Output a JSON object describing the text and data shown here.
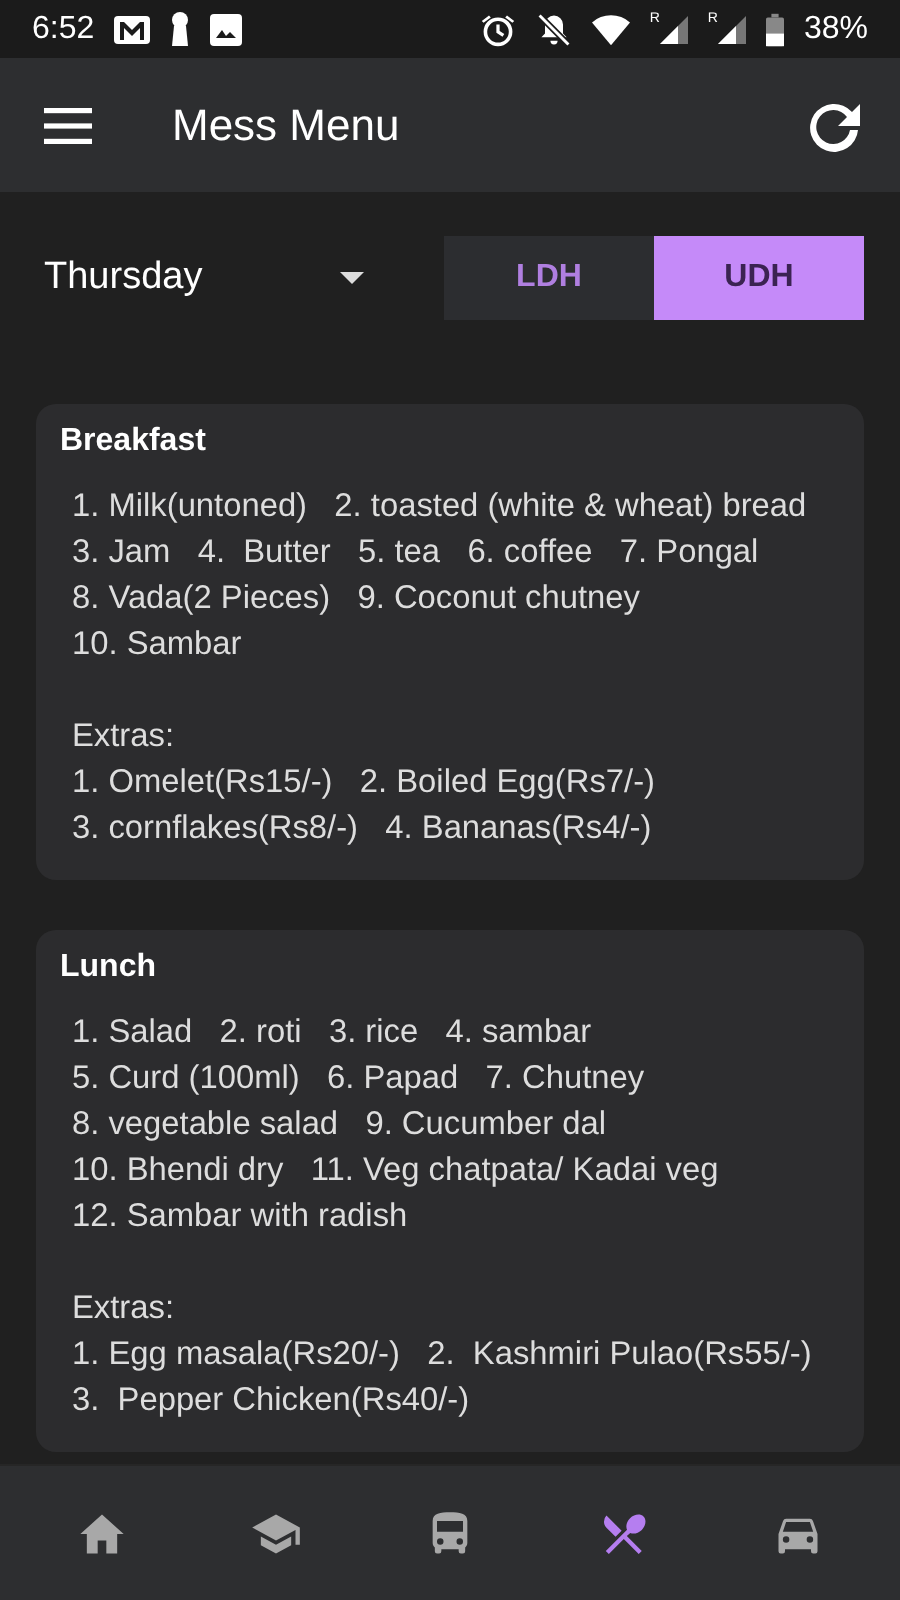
{
  "status_bar": {
    "time": "6:52",
    "signals": [
      {
        "roaming": "R"
      },
      {
        "roaming": "R"
      }
    ],
    "battery": "38%"
  },
  "app_bar": {
    "title": "Mess Menu"
  },
  "day_dropdown": {
    "value": "Thursday"
  },
  "hall_toggle": [
    {
      "label": "LDH",
      "selected": false
    },
    {
      "label": "UDH",
      "selected": true
    }
  ],
  "meals": [
    {
      "title": "Breakfast",
      "lines": [
        "1. Milk(untoned)   2. toasted (white & wheat) bread",
        "3. Jam   4.  Butter   5. tea   6. coffee   7. Pongal",
        "8. Vada(2 Pieces)   9. Coconut chutney",
        "10. Sambar"
      ],
      "extras_label": "Extras:",
      "extras": [
        "1. Omelet(Rs15/-)   2. Boiled Egg(Rs7/-)",
        "3. cornflakes(Rs8/-)   4. Bananas(Rs4/-)"
      ]
    },
    {
      "title": "Lunch",
      "lines": [
        "1. Salad   2. roti   3. rice   4. sambar",
        "5. Curd (100ml)   6. Papad   7. Chutney",
        "8. vegetable salad   9. Cucumber dal",
        "10. Bhendi dry   11. Veg chatpata/ Kadai veg",
        "12. Sambar with radish"
      ],
      "extras_label": "Extras:",
      "extras": [
        "1. Egg masala(Rs20/-)   2.  Kashmiri Pulao(Rs55/-)",
        "3.  Pepper Chicken(Rs40/-)"
      ]
    }
  ],
  "bottom_nav": [
    {
      "kind": "home",
      "selected": false
    },
    {
      "kind": "school",
      "selected": false
    },
    {
      "kind": "bus",
      "selected": false
    },
    {
      "kind": "food",
      "selected": true
    },
    {
      "kind": "car",
      "selected": false
    }
  ]
}
